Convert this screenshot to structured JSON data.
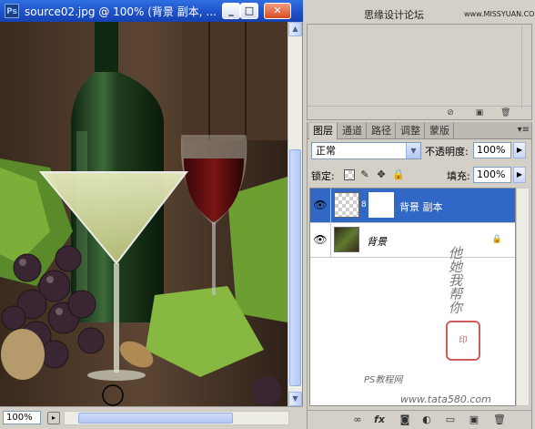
{
  "window": {
    "app_icon": "Ps",
    "title": "source02.jpg @ 100% (背景 副本, ...",
    "minimize": "_",
    "restore": "□",
    "close": "✕",
    "zoom": "100%"
  },
  "watermark_top": {
    "text": "思缘设计论坛",
    "url": "www.MISSYUAN.COM"
  },
  "layers_panel": {
    "tabs": [
      "图层",
      "通道",
      "路径",
      "调整",
      "蒙版"
    ],
    "active_tab": "图层",
    "blend_mode": "正常",
    "opacity_label": "不透明度:",
    "opacity_value": "100%",
    "lock_label": "锁定:",
    "fill_label": "填充:",
    "fill_value": "100%",
    "layers": [
      {
        "name": "背景 副本",
        "selected": true,
        "has_mask": true
      },
      {
        "name": "背景",
        "selected": false,
        "locked": true
      }
    ]
  },
  "watermark_bottom": {
    "handwriting": "他她我帮你",
    "site_cn": "PS教程网",
    "site_url": "www.tata580.com"
  },
  "colors": {
    "titlebar": "#1d4fc7",
    "selected_layer": "#3168c6",
    "panel_bg": "#d4d0c8"
  }
}
